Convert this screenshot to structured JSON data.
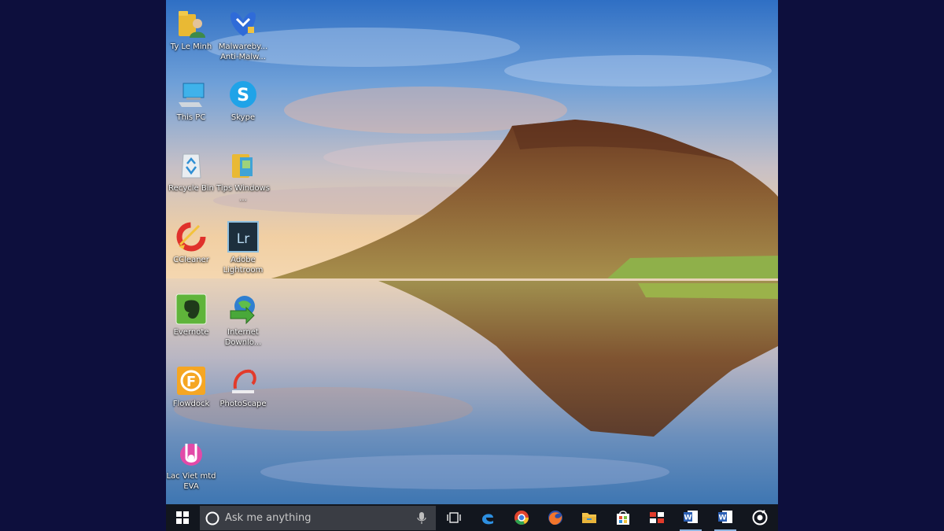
{
  "desktop": {
    "icons": [
      {
        "label": "Ty Le Minh",
        "icon": "user-folder-icon"
      },
      {
        "label": "Malwareby... Anti-Malw...",
        "icon": "malwarebytes-icon"
      },
      {
        "label": "This PC",
        "icon": "computer-icon"
      },
      {
        "label": "Skype",
        "icon": "skype-icon"
      },
      {
        "label": "Recycle Bin",
        "icon": "recycle-bin-icon"
      },
      {
        "label": "Tips Windows ...",
        "icon": "folder-icon"
      },
      {
        "label": "CCleaner",
        "icon": "ccleaner-icon"
      },
      {
        "label": "Adobe Lightroom",
        "icon": "lightroom-icon"
      },
      {
        "label": "Evernote",
        "icon": "evernote-icon"
      },
      {
        "label": "Internet Downlo...",
        "icon": "idm-icon"
      },
      {
        "label": "Flowdock",
        "icon": "flowdock-icon"
      },
      {
        "label": "PhotoScape",
        "icon": "photoscape-icon"
      },
      {
        "label": "Lac Viet mtd EVA",
        "icon": "lac-viet-icon"
      }
    ]
  },
  "lightroom_glyph": "Lr",
  "skype_glyph": "S",
  "flowdock_glyph": "F",
  "taskbar": {
    "search": {
      "placeholder": "Ask me anything"
    },
    "pinned": [
      "edge-icon",
      "chrome-icon",
      "firefox-icon",
      "file-explorer-icon",
      "store-icon",
      "app-icon",
      "word-icon",
      "word-icon",
      "settings-circle-icon"
    ],
    "word_glyph": "W"
  },
  "colors": {
    "background": "#0d0f3d",
    "taskbar": "#12161e",
    "search_box": "#3a3d44"
  }
}
